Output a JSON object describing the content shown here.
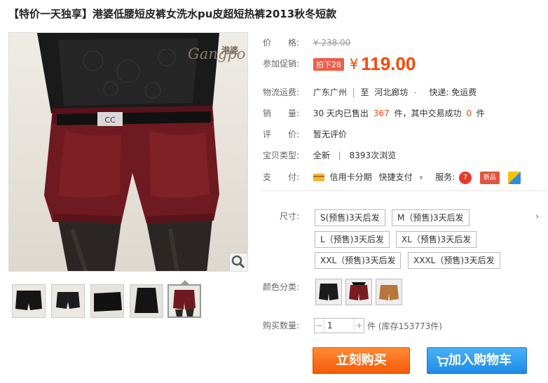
{
  "title": "【特价一天独享】港婆低腰短皮裤女洗水pu皮超短热裤2013秋冬短款",
  "brand": {
    "cn": "港婆",
    "en": "Gangpo"
  },
  "rows": {
    "price": {
      "label": "价　　格:",
      "value": "¥ 238.00"
    },
    "promo": {
      "label": "参加促销:",
      "badge": "拍下28",
      "symbol": "¥",
      "value": "119.00"
    },
    "logistics": {
      "label": "物流运费:",
      "from": "广东广州",
      "sep1": "|",
      "to_prefix": "至",
      "to": "河北廊坊",
      "caret": "-",
      "ship_text": "快递: 免运费"
    },
    "sales": {
      "label": "销　　量:",
      "prefix": "30 天内已售出",
      "sold": "367",
      "mid": "件，其中交易成功",
      "success": "0",
      "suffix": "件"
    },
    "reviews": {
      "label": "评　　价:",
      "value": "暂无评价"
    },
    "type": {
      "label": "宝贝类型:",
      "cond": "全新",
      "sep": "|",
      "views": "8393次浏览"
    },
    "pay": {
      "label": "支　　付:",
      "credit": "信用卡分期",
      "quick": "快捷支付",
      "caret": "▾",
      "service_label": "服务:",
      "svc1": "7",
      "svc2": "新品"
    }
  },
  "sku": {
    "size_label": "尺寸:",
    "sizes": [
      "S(预售)3天后发",
      "M（预售)3天后发",
      "L（预售)3天后发",
      "XL（预售)3天后发",
      "XXL（预售)3天后发",
      "XXXL（预售)3天后发"
    ],
    "more": "›",
    "color_label": "颜色分类:",
    "colors": [
      {
        "name": "black",
        "hex": "#1b1b1b"
      },
      {
        "name": "wine-red",
        "hex": "#7a1b22"
      },
      {
        "name": "camel",
        "hex": "#b8763a"
      }
    ]
  },
  "quantity": {
    "label": "购买数量:",
    "value": "1",
    "minus": "−",
    "plus": "+",
    "unit": "件 (库存153773件)"
  },
  "actions": {
    "buy": "立刻购买",
    "cart": "加入购物车"
  },
  "colors": {
    "accent": "#ff4400",
    "buy": "#f55a06",
    "cart": "#1d8be8"
  }
}
